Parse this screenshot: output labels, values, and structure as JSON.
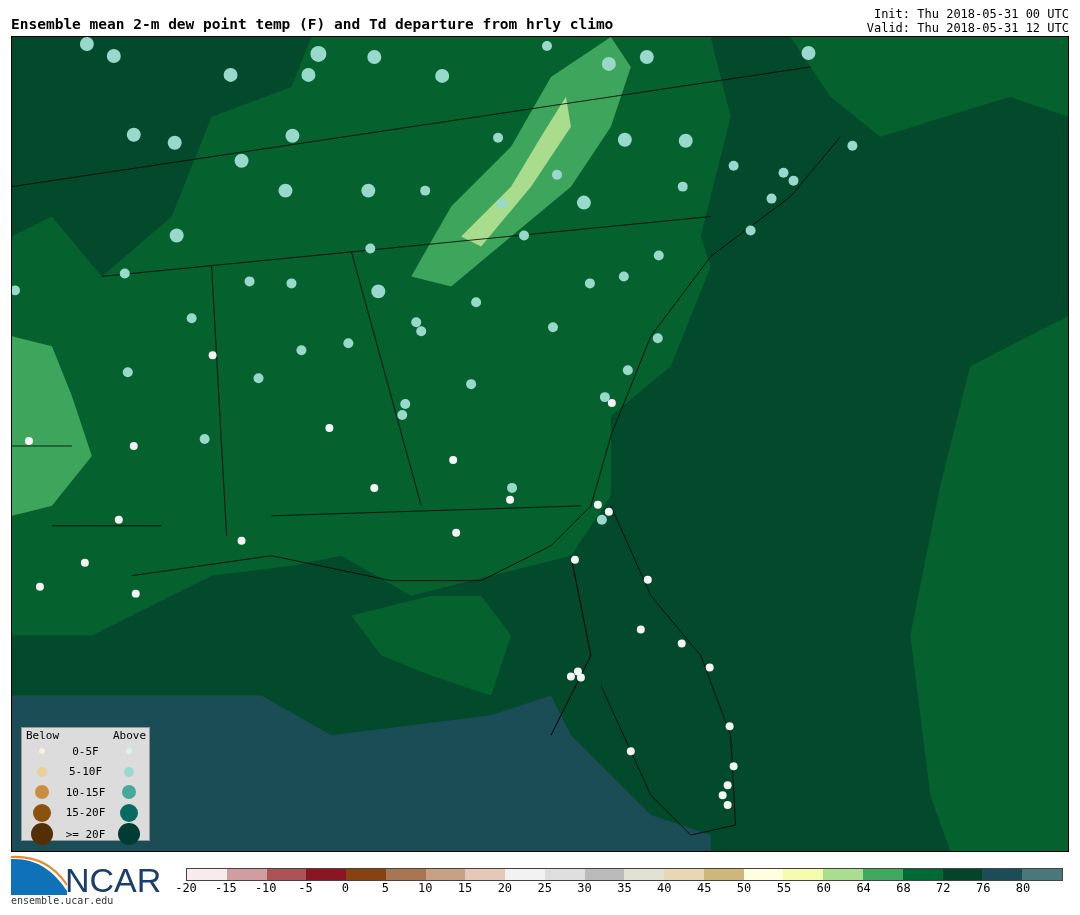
{
  "title": "Ensemble mean 2-m dew point temp (F) and Td departure from hrly climo",
  "init": "Init: Thu 2018-05-31 00 UTC",
  "valid": "Valid: Thu 2018-05-31 12 UTC",
  "legend": {
    "below_header": "Below",
    "above_header": "Above",
    "rows": [
      {
        "label": "0-5F",
        "below": {
          "color": "#faf0dc"
        },
        "above": {
          "color": "#e0f2ee"
        }
      },
      {
        "label": "5-10F",
        "below": {
          "color": "#ecd095"
        },
        "above": {
          "color": "#99d9cc"
        }
      },
      {
        "label": "10-15F",
        "below": {
          "color": "#c98f40"
        },
        "above": {
          "color": "#45a898"
        }
      },
      {
        "label": "15-20F",
        "below": {
          "color": "#8a520d"
        },
        "above": {
          "color": "#076b60"
        }
      },
      {
        "label": ">= 20F",
        "below": {
          "color": "#523004"
        },
        "above": {
          "color": "#013c32"
        }
      }
    ]
  },
  "logo": {
    "text": "NCAR",
    "url": "ensemble.ucar.edu"
  },
  "colorbar": {
    "segments": [
      {
        "color": "#f7ebeb"
      },
      {
        "color": "#d19ea0"
      },
      {
        "color": "#ad5356"
      },
      {
        "color": "#8b1520"
      },
      {
        "color": "#86430f"
      },
      {
        "color": "#a87752"
      },
      {
        "color": "#c8a184"
      },
      {
        "color": "#e5c9b6"
      },
      {
        "color": "#f2f2f2"
      },
      {
        "color": "#dedede"
      },
      {
        "color": "#bababa"
      },
      {
        "color": "#e2e2d3"
      },
      {
        "color": "#e8d7b3"
      },
      {
        "color": "#cfb67a"
      },
      {
        "color": "#fefee0"
      },
      {
        "color": "#f4fbad"
      },
      {
        "color": "#aade8f"
      },
      {
        "color": "#3faa5f"
      },
      {
        "color": "#006a34"
      },
      {
        "color": "#03442a"
      },
      {
        "color": "#1b4c57"
      },
      {
        "color": "#49787a"
      }
    ],
    "ticks": [
      "-20",
      "-15",
      "-10",
      "-5",
      "0",
      "5",
      "10",
      "15",
      "20",
      "25",
      "30",
      "35",
      "40",
      "45",
      "50",
      "55",
      "60",
      "64",
      "68",
      "72",
      "76",
      "80"
    ]
  }
}
